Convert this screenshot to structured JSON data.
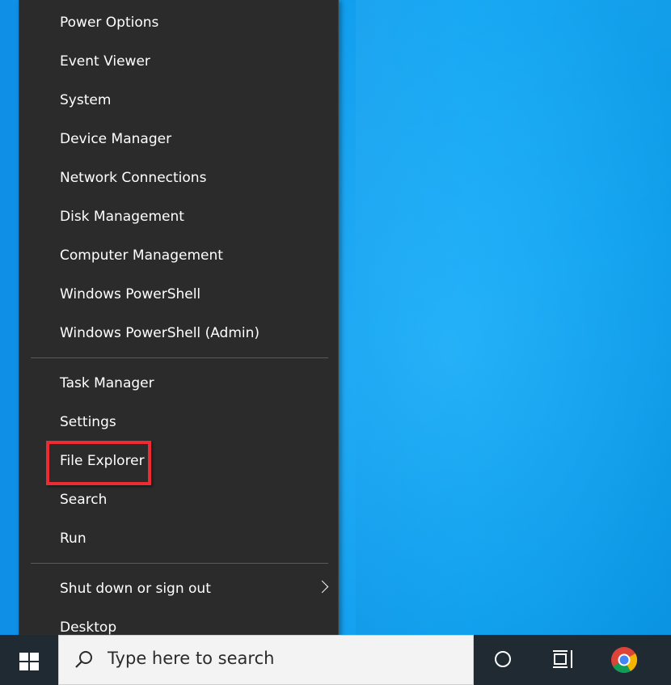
{
  "menu": {
    "items": [
      {
        "label": "Power Options"
      },
      {
        "label": "Event Viewer"
      },
      {
        "label": "System"
      },
      {
        "label": "Device Manager"
      },
      {
        "label": "Network Connections"
      },
      {
        "label": "Disk Management"
      },
      {
        "label": "Computer Management"
      },
      {
        "label": "Windows PowerShell"
      },
      {
        "label": "Windows PowerShell (Admin)"
      },
      {
        "label": "Task Manager"
      },
      {
        "label": "Settings"
      },
      {
        "label": "File Explorer",
        "highlighted": true
      },
      {
        "label": "Search"
      },
      {
        "label": "Run"
      },
      {
        "label": "Shut down or sign out",
        "has_submenu": true
      },
      {
        "label": "Desktop"
      }
    ],
    "highlight_color": "#ee2a32"
  },
  "taskbar": {
    "search_placeholder": "Type here to search",
    "icons": [
      "windows-start-icon",
      "search-icon",
      "cortana-icon",
      "task-view-icon",
      "chrome-icon"
    ]
  },
  "colors": {
    "menu_bg": "#2b2b2b",
    "taskbar_bg": "#1f2a33",
    "desktop_blue": "#0aa3f2"
  }
}
